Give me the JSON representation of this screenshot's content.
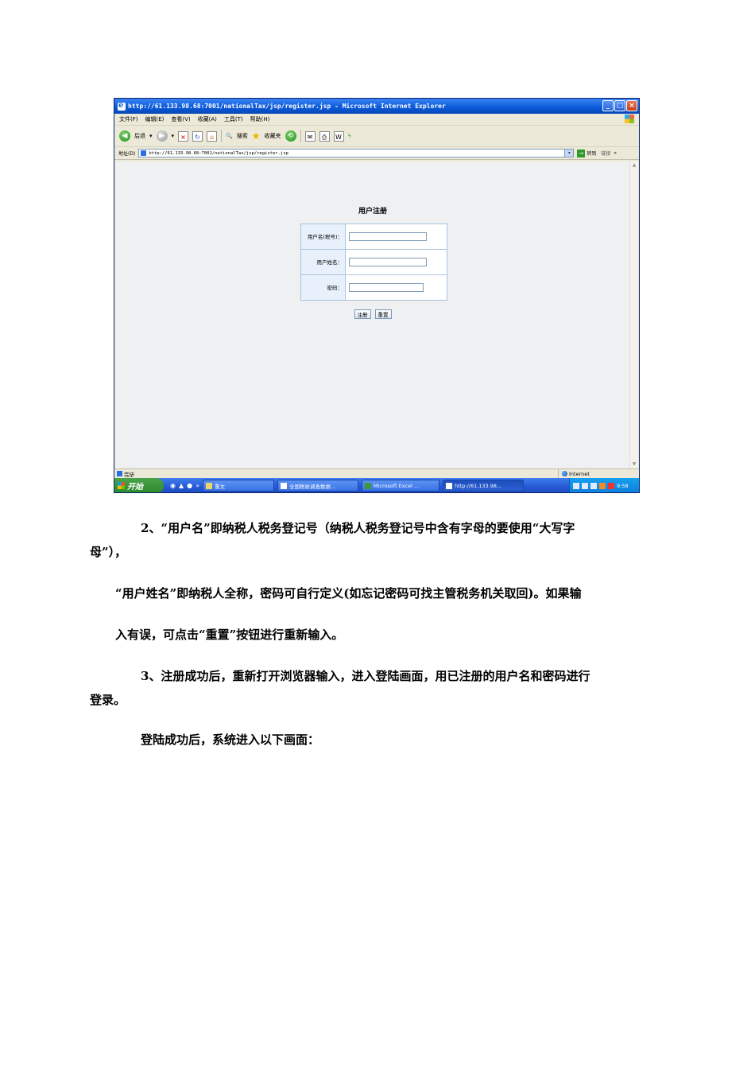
{
  "browser": {
    "title": "http://61.133.98.68:7001/nationalTax/jsp/register.jsp - Microsoft Internet Explorer",
    "menus": [
      "文件(F)",
      "编辑(E)",
      "查看(V)",
      "收藏(A)",
      "工具(T)",
      "帮助(H)"
    ],
    "toolbar": {
      "back": "后退",
      "search": "搜索",
      "favorites": "收藏夹"
    },
    "address_label": "地址(D)",
    "address": "http://61.133.98.68:7001/nationalTax/jsp/register.jsp",
    "go": "转到",
    "links": "链接",
    "status": "完毕",
    "zone": "Internet"
  },
  "register": {
    "title": "用户注册",
    "fields": [
      {
        "label": "用户名(税号)：",
        "value": ""
      },
      {
        "label": "用户姓名：",
        "value": ""
      },
      {
        "label": "密码：",
        "value": ""
      }
    ],
    "submit": "注册",
    "reset": "重置"
  },
  "taskbar": {
    "start": "开始",
    "tasks": [
      "重文",
      "全国税收调查数据...",
      "Microsoft Excel ...",
      "http://61.133.98..."
    ],
    "clock": "9:58"
  },
  "document": {
    "p1_line1": "2、“用户名”即纳税人税务登记号（纳税人税务登记号中含有字母的要使用“大写字",
    "p1_line2": "母”），",
    "p2": "“用户姓名”即纳税人全称，密码可自行定义(如忘记密码可找主管税务机关取回)。如果输",
    "p3": "入有误，可点击“重置”按钮进行重新输入。",
    "p4_line1": "3、注册成功后，重新打开浏览器输入，进入登陆画面，用已注册的用户名和密码进行",
    "p4_line2": "登录。",
    "p5": "登陆成功后，系统进入以下画面："
  }
}
